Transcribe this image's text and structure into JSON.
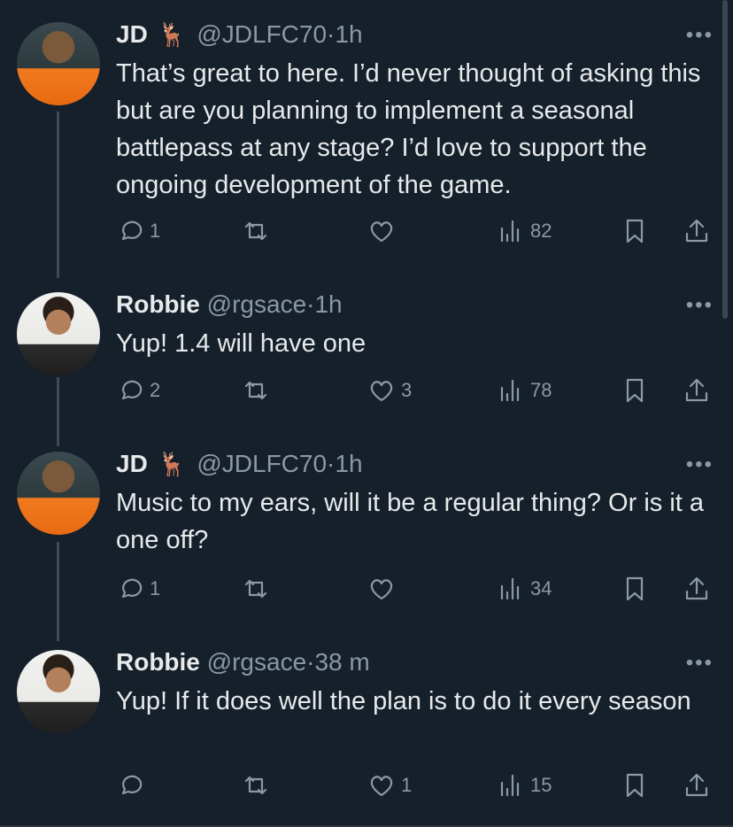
{
  "tweets": [
    {
      "name": "JD",
      "emoji": "🦌",
      "handle": "@JDLFC70",
      "sep": "·",
      "time": "1h",
      "text": "That’s great to here. I’d never thought of asking this but are you planning to implement a seasonal battlepass at any stage? I’d love to support the ongoing development of the game.",
      "replies": "1",
      "retweets": "",
      "likes": "",
      "views": "82"
    },
    {
      "name": "Robbie",
      "handle": "@rgsace",
      "sep": "·",
      "time": "1h",
      "text": "Yup! 1.4 will have one",
      "replies": "2",
      "retweets": "",
      "likes": "3",
      "views": "78"
    },
    {
      "name": "JD",
      "emoji": "🦌",
      "handle": "@JDLFC70",
      "sep": "·",
      "time": "1h",
      "text": "Music to my ears, will it be a regular thing? Or is it a one off?",
      "replies": "1",
      "retweets": "",
      "likes": "",
      "views": "34"
    },
    {
      "name": "Robbie",
      "handle": "@rgsace",
      "sep": "·",
      "time": "38 m",
      "text": "Yup! If it does well the plan is to do it every season",
      "replies": "",
      "retweets": "",
      "likes": "1",
      "views": "15"
    }
  ],
  "icons": {
    "more": "more-icon",
    "reply": "reply-icon",
    "retweet": "retweet-icon",
    "like": "heart-icon",
    "views": "views-icon",
    "bookmark": "bookmark-icon",
    "share": "share-icon"
  },
  "colors": {
    "background": "#15202b",
    "text": "#e7e9ea",
    "muted": "#8b98a5"
  }
}
